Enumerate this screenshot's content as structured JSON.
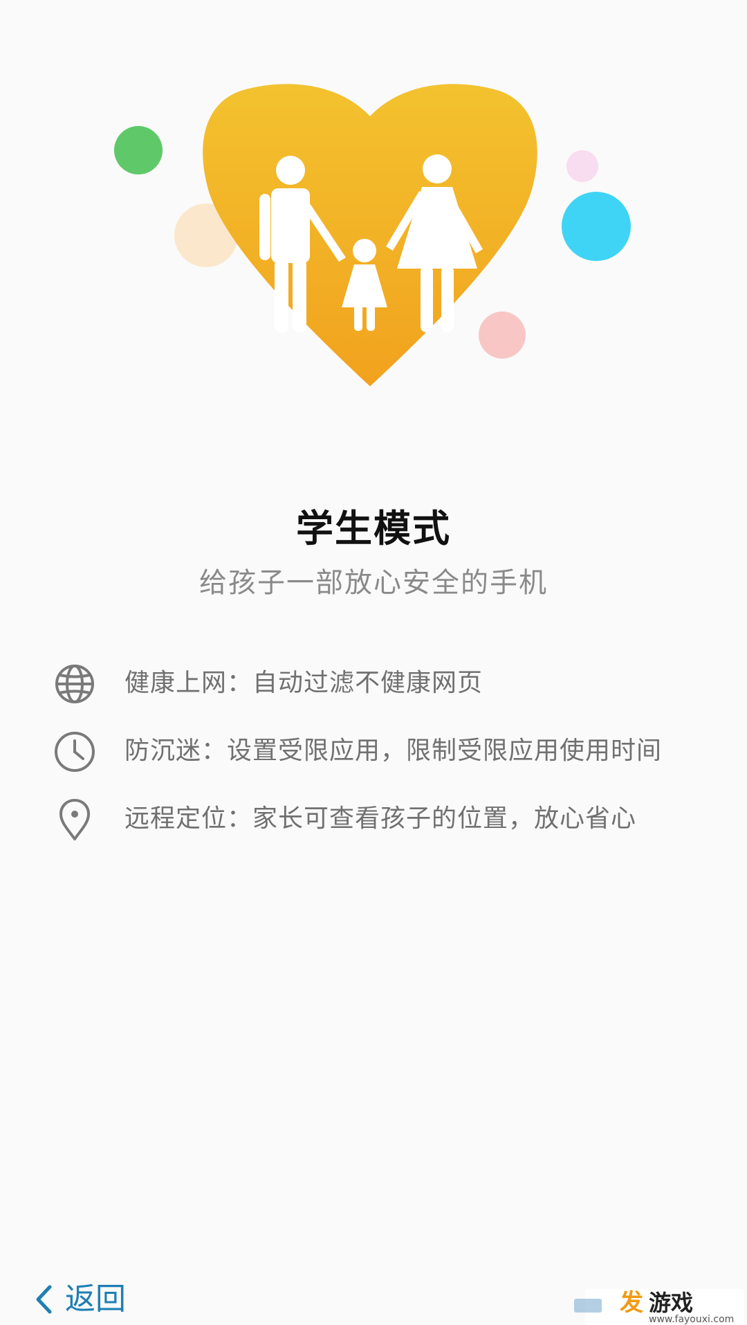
{
  "hero": {
    "illustration": "family-heart-illustration",
    "colors": {
      "heart_top": "#f3c22f",
      "heart_bottom": "#f2a21e",
      "bubble_green": "#5fc96a",
      "bubble_cream": "#fbe8cc",
      "bubble_pink_light": "#f8dcef",
      "bubble_cyan": "#3fd4f5",
      "bubble_pink": "#f9c6c6"
    }
  },
  "header": {
    "title": "学生模式",
    "subtitle": "给孩子一部放心安全的手机"
  },
  "features": [
    {
      "icon": "globe-icon",
      "text": "健康上网：自动过滤不健康网页"
    },
    {
      "icon": "clock-icon",
      "text": "防沉迷：设置受限应用，限制受限应用使用时间"
    },
    {
      "icon": "location-pin-icon",
      "text": "远程定位：家长可查看孩子的位置，放心省心"
    }
  ],
  "footer": {
    "back_label": "返回",
    "accent_color": "#1e7fb3"
  },
  "watermark": {
    "glyph": "发",
    "text": "游戏",
    "url": "www.fayouxi.com"
  }
}
